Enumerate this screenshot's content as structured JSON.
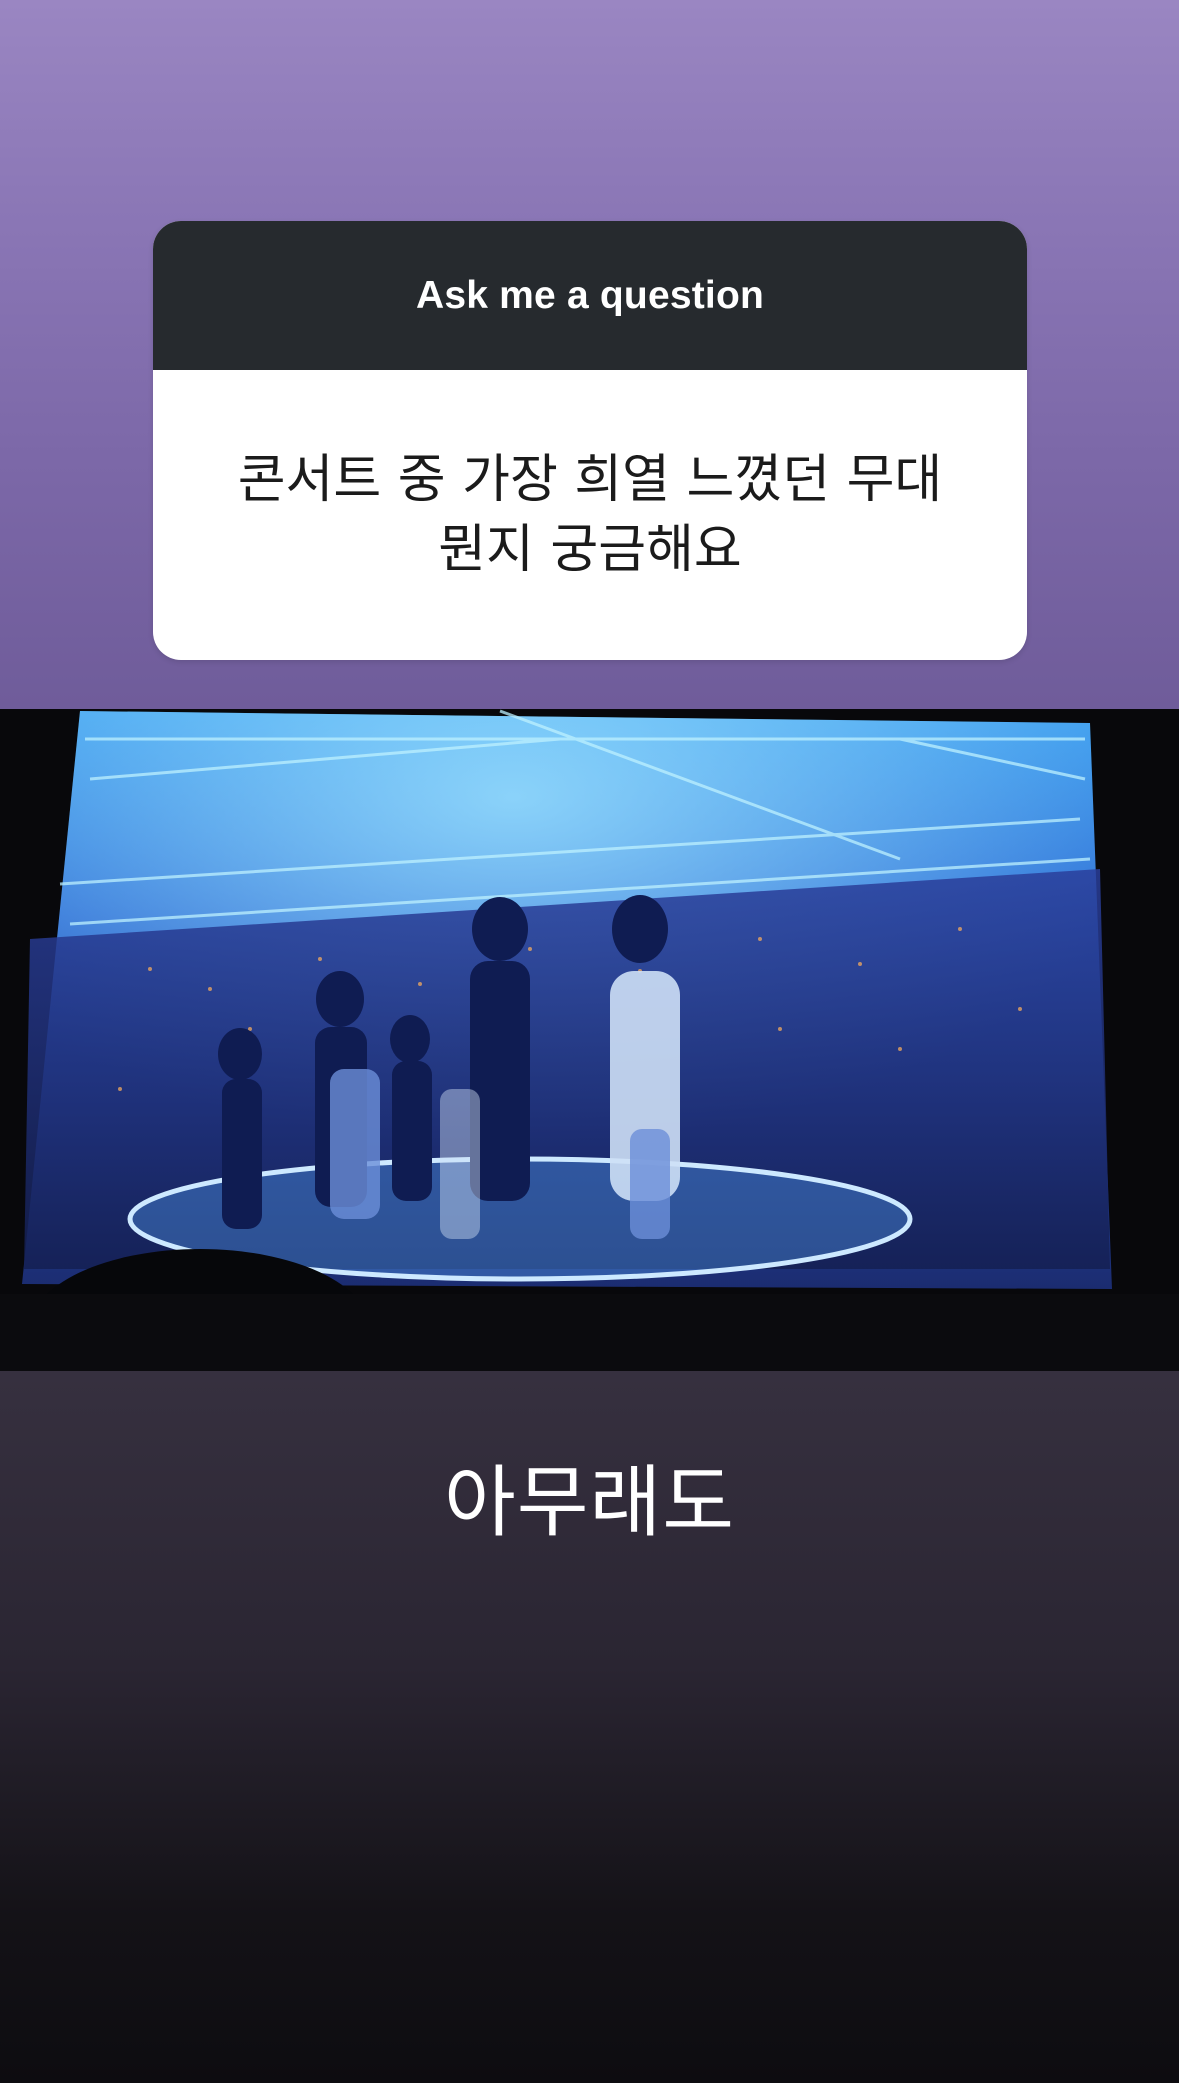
{
  "question_sticker": {
    "header": "Ask me a question",
    "question": "콘서트 중 가장 희열 느꼈던 무대 뭔지 궁금해요"
  },
  "photo": {
    "description_icon": "concert-stage-photo"
  },
  "answer_text": "아무래도",
  "colors": {
    "sticker_header": "#262a2e",
    "sticker_body": "#ffffff",
    "bg_top": "#9a86c2",
    "bg_bottom": "#0d0c10"
  }
}
